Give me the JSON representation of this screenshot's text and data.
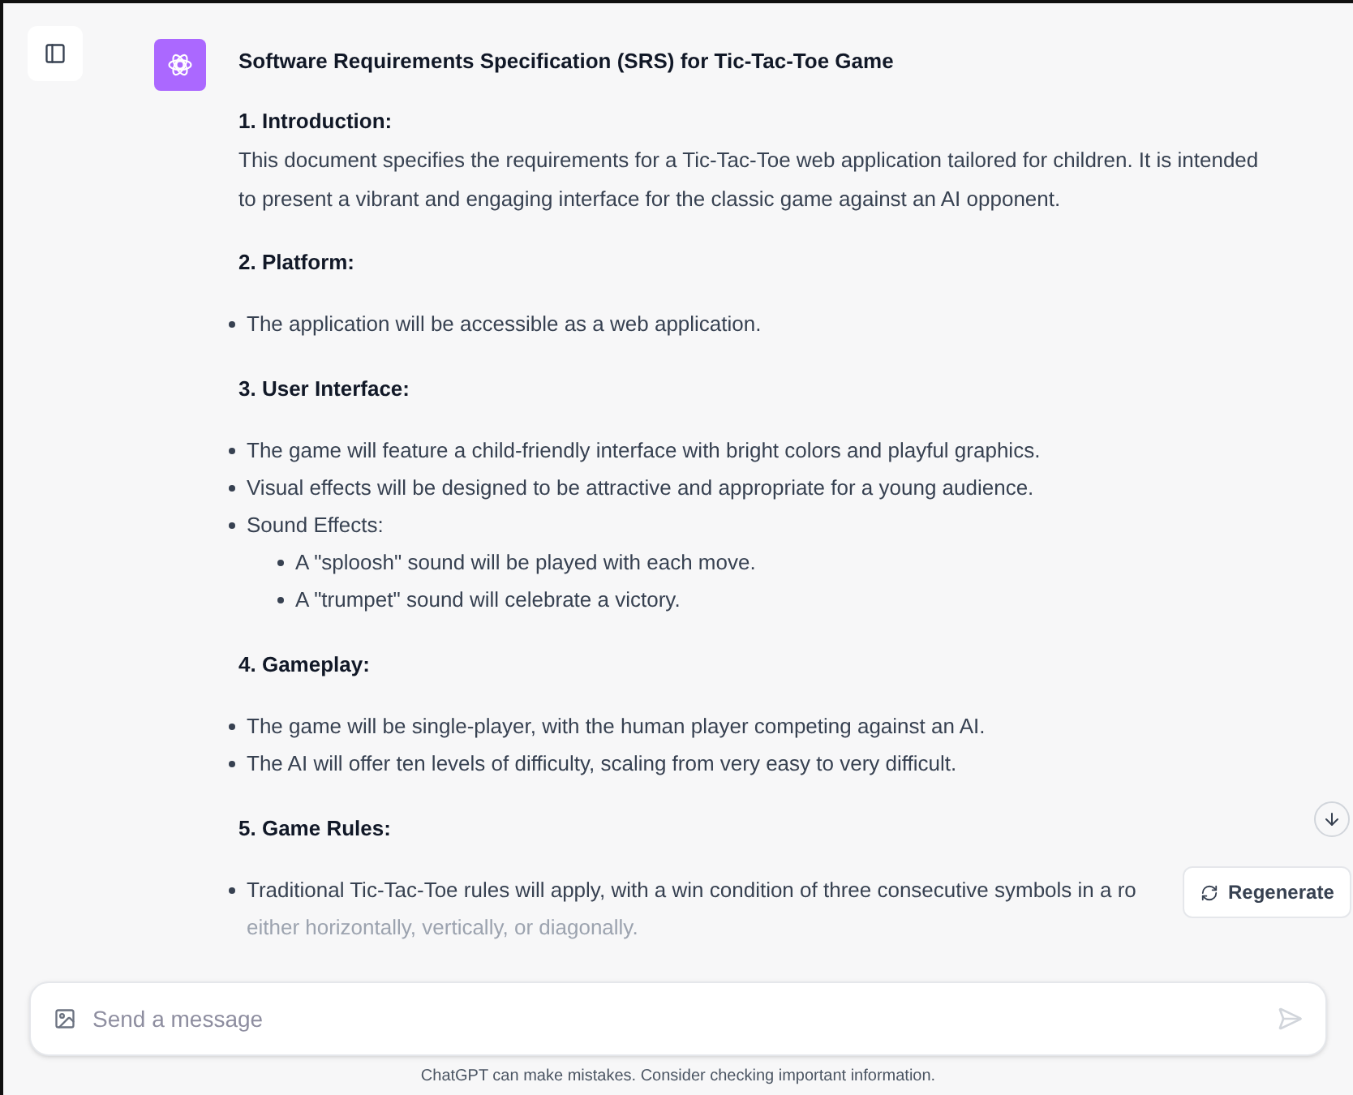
{
  "title": "Software Requirements Specification (SRS) for Tic-Tac-Toe Game",
  "sections": [
    {
      "heading": "1. Introduction:",
      "paragraph": "This document specifies the requirements for a Tic-Tac-Toe web application tailored for children. It is intended to present a vibrant and engaging interface for the classic game against an AI opponent."
    },
    {
      "heading": "2. Platform:",
      "items": [
        {
          "text": "The application will be accessible as a web application."
        }
      ]
    },
    {
      "heading": "3. User Interface:",
      "items": [
        {
          "text": "The game will feature a child-friendly interface with bright colors and playful graphics."
        },
        {
          "text": "Visual effects will be designed to be attractive and appropriate for a young audience."
        },
        {
          "text": "Sound Effects:",
          "children": [
            {
              "text": "A \"sploosh\" sound will be played with each move."
            },
            {
              "text": "A \"trumpet\" sound will celebrate a victory."
            }
          ]
        }
      ]
    },
    {
      "heading": "4. Gameplay:",
      "items": [
        {
          "text": "The game will be single-player, with the human player competing against an AI."
        },
        {
          "text": "The AI will offer ten levels of difficulty, scaling from very easy to very difficult."
        }
      ]
    },
    {
      "heading": "5. Game Rules:",
      "items": [
        {
          "text": "Traditional Tic-Tac-Toe rules will apply, with a win condition of three consecutive symbols in a ro",
          "continuation": "either horizontally, vertically, or diagonally."
        }
      ]
    }
  ],
  "regenerate_button": "Regenerate",
  "composer": {
    "placeholder": "Send a message"
  },
  "footer": "ChatGPT can make mistakes. Consider checking important information."
}
